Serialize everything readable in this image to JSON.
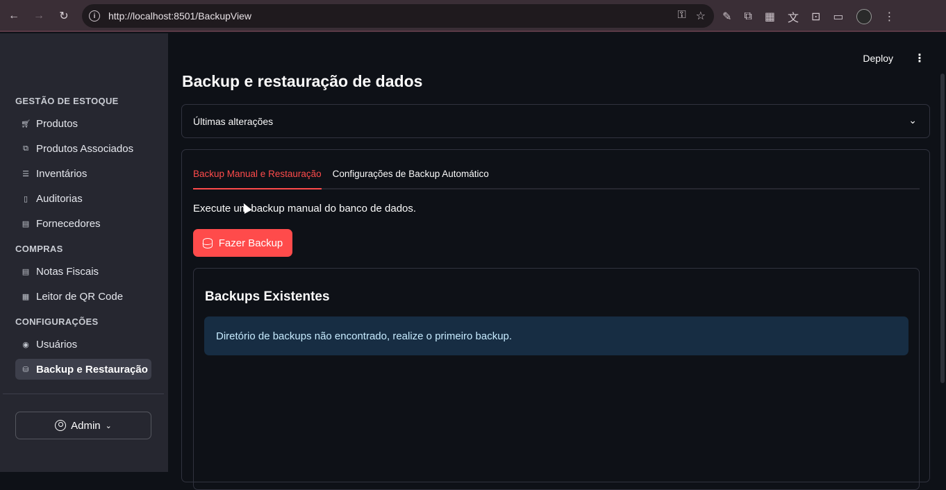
{
  "browser": {
    "url": "http://localhost:8501/BackupView"
  },
  "sidebar": {
    "sections": [
      {
        "title": "GESTÃO DE ESTOQUE",
        "items": [
          {
            "label": "Produtos",
            "icon": "cart-icon"
          },
          {
            "label": "Produtos Associados",
            "icon": "library-icon"
          },
          {
            "label": "Inventários",
            "icon": "list-icon"
          },
          {
            "label": "Auditorias",
            "icon": "file-icon"
          },
          {
            "label": "Fornecedores",
            "icon": "store-icon"
          }
        ]
      },
      {
        "title": "COMPRAS",
        "items": [
          {
            "label": "Notas Fiscais",
            "icon": "receipt-icon"
          },
          {
            "label": "Leitor de QR Code",
            "icon": "qr-code-icon"
          }
        ]
      },
      {
        "title": "CONFIGURAÇÕES",
        "items": [
          {
            "label": "Usuários",
            "icon": "user-circle-icon"
          },
          {
            "label": "Backup e Restauração",
            "icon": "database-icon",
            "active": true
          }
        ]
      }
    ],
    "user_button": "Admin"
  },
  "header": {
    "deploy": "Deploy"
  },
  "main": {
    "title": "Backup e restauração de dados",
    "expander": "Últimas alterações",
    "tabs": [
      "Backup Manual e Restauração",
      "Configurações de Backup Automático"
    ],
    "description": "Execute um backup manual do banco de dados.",
    "backup_button": "Fazer Backup",
    "existing_title": "Backups Existentes",
    "info_message": "Diretório de backups não encontrado, realize o primeiro backup."
  },
  "colors": {
    "accent": "#ff4b4b",
    "info_bg": "#172d43",
    "info_text": "#c7ebff"
  }
}
